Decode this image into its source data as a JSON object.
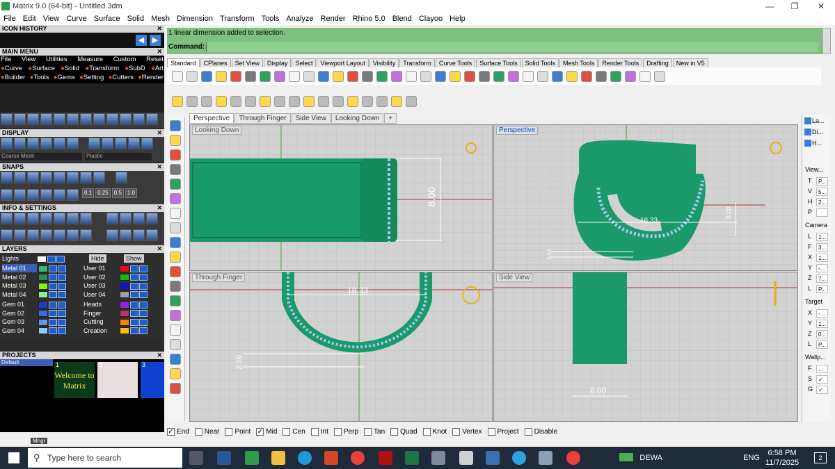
{
  "window": {
    "title": "Matrix 9.0 (64-bit) - Untitled.3dm",
    "min": "—",
    "max": "❐",
    "close": "✕"
  },
  "menu": [
    "File",
    "Edit",
    "View",
    "Curve",
    "Surface",
    "Solid",
    "Mesh",
    "Dimension",
    "Transform",
    "Tools",
    "Analyze",
    "Render",
    "Rhino 5.0",
    "Blend",
    "Clayoo",
    "Help"
  ],
  "left": {
    "icon_history": "ICON HISTORY",
    "main_menu": "MAIN MENU",
    "main_row1": [
      "File",
      "View",
      "Utilities",
      "Measure",
      "Custom",
      "Reset"
    ],
    "main_row2": [
      "Curve",
      "Surface",
      "Solid",
      "Transform",
      "SubD",
      "Art"
    ],
    "main_row3": [
      "Builder",
      "Tools",
      "Gems",
      "Setting",
      "Cutters",
      "Render"
    ],
    "display": "DISPLAY",
    "display_sel1": "Coarse Mesh",
    "display_sel2": "Plastic",
    "snaps": "SNAPS",
    "snap_vals": [
      "0.1",
      "0.25",
      "0.5",
      "1.0"
    ],
    "info": "INFO & SETTINGS",
    "layers": "LAYERS",
    "lights": "Lights",
    "hide": "Hide",
    "show": "Show",
    "layers_left": [
      {
        "name": "Metal 01",
        "color": "#3cb371"
      },
      {
        "name": "Metal 02",
        "color": "#2e8b57"
      },
      {
        "name": "Metal 03",
        "color": "#7cfc00"
      },
      {
        "name": "Metal 04",
        "color": "#90ee90"
      },
      {
        "name": "Gem 01",
        "color": "#1e3cc8"
      },
      {
        "name": "Gem 02",
        "color": "#4169e1"
      },
      {
        "name": "Gem 03",
        "color": "#6495ed"
      },
      {
        "name": "Gem 04",
        "color": "#87cefa"
      }
    ],
    "layers_right": [
      {
        "name": "User 01",
        "color": "#e01010"
      },
      {
        "name": "User 02",
        "color": "#10c010"
      },
      {
        "name": "User 03",
        "color": "#1010e0"
      },
      {
        "name": "User 04",
        "color": "#a0a0a0"
      },
      {
        "name": "Heads",
        "color": "#8a2be2"
      },
      {
        "name": "Finger",
        "color": "#c03060"
      },
      {
        "name": "Cutting",
        "color": "#ff8000"
      },
      {
        "name": "Creation",
        "color": "#ffc000"
      }
    ],
    "projects": "PROJECTS",
    "project_default": "Default",
    "thumb_nums": [
      "1",
      "2",
      "3"
    ],
    "thumb1_text": "Welcome to Matrix",
    "mngr": "Mngr"
  },
  "command": {
    "history": "1 linear dimension added to selection.",
    "label": "Command:"
  },
  "tabs": [
    "Standard",
    "CPlanes",
    "Set View",
    "Display",
    "Select",
    "Viewport Layout",
    "Visibility",
    "Transform",
    "Curve Tools",
    "Surface Tools",
    "Solid Tools",
    "Mesh Tools",
    "Render Tools",
    "Drafting",
    "New in V5"
  ],
  "viewport_tabs": [
    "Perspective",
    "Through Finger",
    "Side View",
    "Looking Down",
    "+"
  ],
  "viewports": {
    "tl": {
      "label": "Looking Down",
      "dim": "8.00"
    },
    "tr": {
      "label": "Perspective",
      "dim1": "18.33",
      "dim2": "8.00",
      "dim3": "2.16"
    },
    "bl": {
      "label": "Through Finger",
      "dim1": "18.33",
      "dim2": "2.16"
    },
    "br": {
      "label": "Side View",
      "dim": "8.00"
    }
  },
  "right_panel": {
    "tabs": [
      "La...",
      "Di...",
      "H..."
    ],
    "view_label": "View...",
    "view_rows": [
      [
        "T",
        "P..."
      ],
      [
        "V",
        "5..."
      ],
      [
        "H",
        "2..."
      ],
      [
        "P",
        ""
      ]
    ],
    "camera_label": "Camera",
    "camera_rows": [
      [
        "L",
        "1..."
      ],
      [
        "F",
        "3..."
      ],
      [
        "X",
        "1..."
      ],
      [
        "Y",
        "-..."
      ],
      [
        "Z",
        "7..."
      ],
      [
        "L",
        "P..."
      ]
    ],
    "target_label": "Target",
    "target_rows": [
      [
        "X",
        "-..."
      ],
      [
        "Y",
        "1..."
      ],
      [
        "Z",
        "0..."
      ],
      [
        "L",
        "P..."
      ]
    ],
    "wall_label": "Wallp...",
    "wall_rows": [
      [
        "F",
        "..."
      ],
      [
        "S",
        "✓"
      ],
      [
        "G",
        "✓"
      ]
    ]
  },
  "osnaps": [
    {
      "label": "End",
      "checked": true
    },
    {
      "label": "Near",
      "checked": false
    },
    {
      "label": "Point",
      "checked": false
    },
    {
      "label": "Mid",
      "checked": true
    },
    {
      "label": "Cen",
      "checked": false
    },
    {
      "label": "Int",
      "checked": false
    },
    {
      "label": "Perp",
      "checked": false
    },
    {
      "label": "Tan",
      "checked": false
    },
    {
      "label": "Quad",
      "checked": false
    },
    {
      "label": "Knot",
      "checked": false
    },
    {
      "label": "Vertex",
      "checked": false
    },
    {
      "label": "Project",
      "checked": false
    },
    {
      "label": "Disable",
      "checked": false
    }
  ],
  "taskbar": {
    "search_placeholder": "Type here to search",
    "network": "DEWA",
    "lang": "ENG",
    "time": "6:58 PM",
    "date": "11/7/2025",
    "notif": "2"
  },
  "colors": {
    "model": "#1a9a6a",
    "gem": "#a8c8f0",
    "cmd_bg": "#7fbf7f",
    "dim": "#ffffff"
  }
}
